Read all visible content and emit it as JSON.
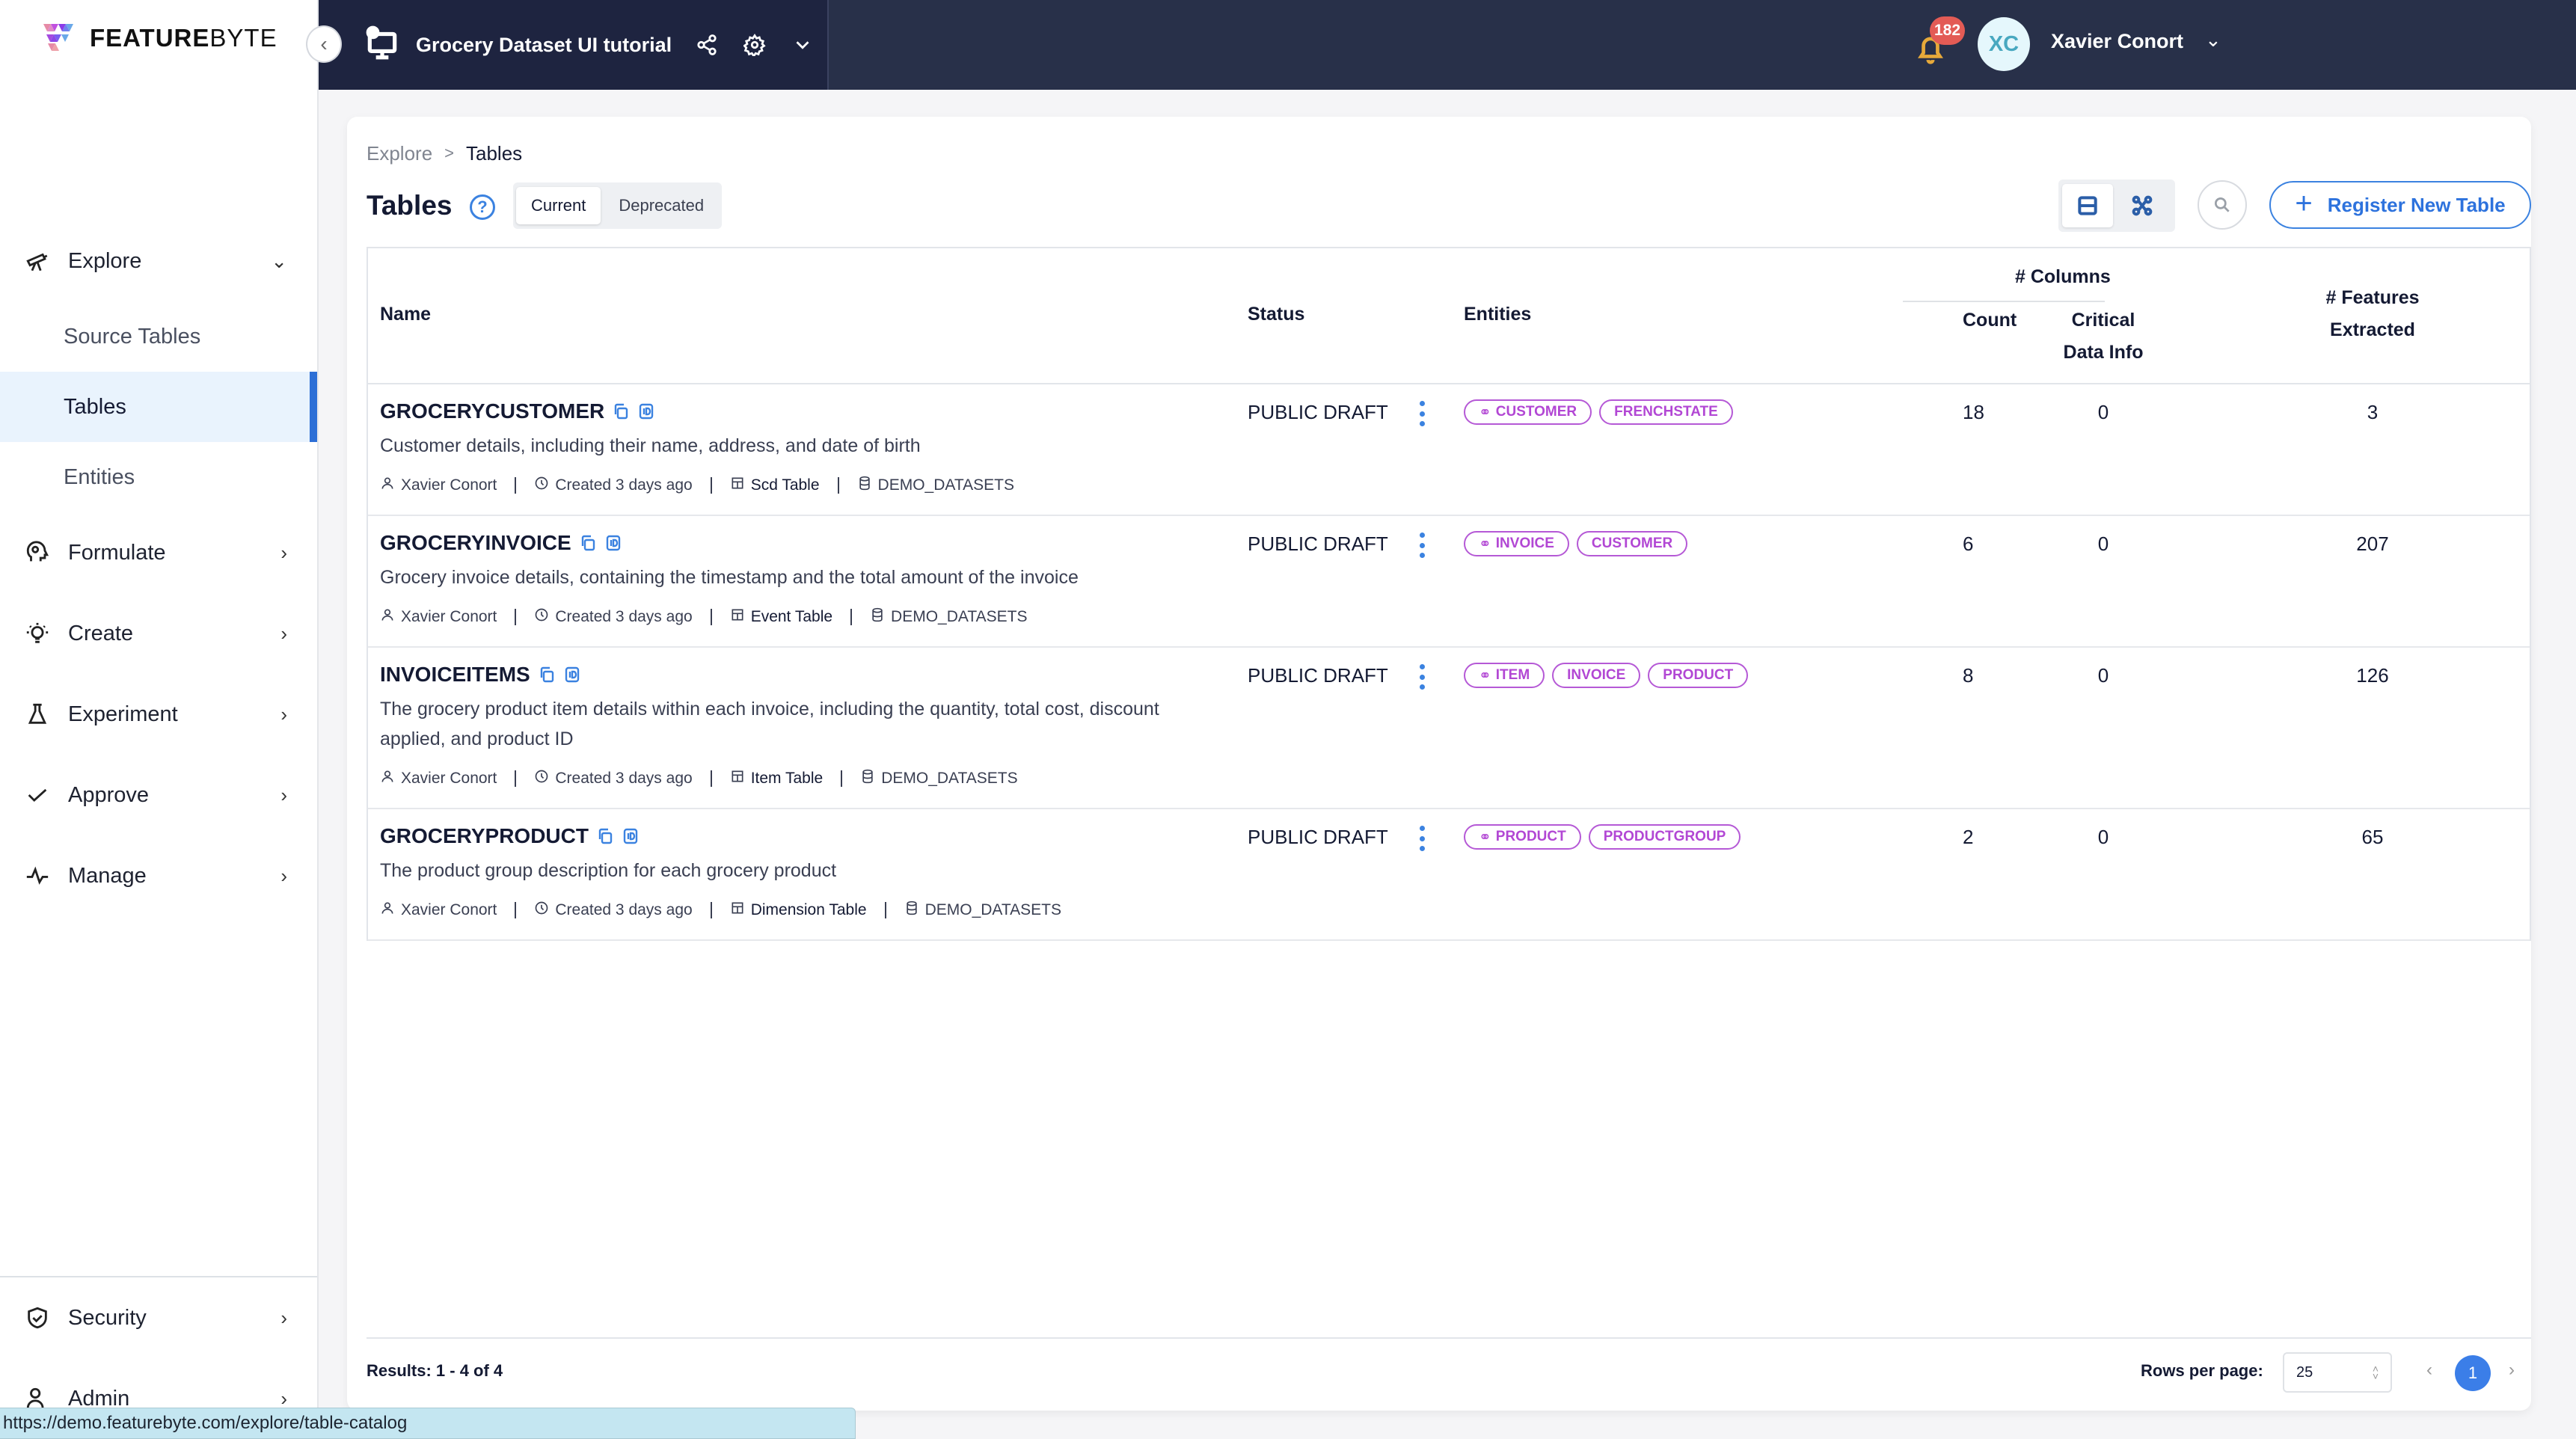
{
  "brand": {
    "name_bold": "FEATURE",
    "name_light": "BYTE"
  },
  "topbar": {
    "project_title": "Grocery Dataset UI tutorial",
    "notification_count": "182",
    "user_initials": "XC",
    "user_name": "Xavier Conort",
    "colors": {
      "bar": "#283049",
      "badge": "#e35b55",
      "bell": "#e7a93a"
    }
  },
  "sidebar": {
    "items": [
      {
        "label": "Explore",
        "icon": "telescope-icon",
        "expanded": true,
        "children": [
          {
            "label": "Source Tables",
            "active": false
          },
          {
            "label": "Tables",
            "active": true
          },
          {
            "label": "Entities",
            "active": false
          }
        ]
      },
      {
        "label": "Formulate",
        "icon": "brain-gear-icon"
      },
      {
        "label": "Create",
        "icon": "lightbulb-icon"
      },
      {
        "label": "Experiment",
        "icon": "flask-icon"
      },
      {
        "label": "Approve",
        "icon": "check-icon"
      },
      {
        "label": "Manage",
        "icon": "pulse-icon"
      }
    ],
    "bottom_items": [
      {
        "label": "Security",
        "icon": "shield-check-icon"
      },
      {
        "label": "Admin",
        "icon": "users-icon"
      }
    ]
  },
  "breadcrumb": {
    "parent": "Explore",
    "separator": ">",
    "current": "Tables"
  },
  "page": {
    "title": "Tables",
    "help": "?",
    "tabs": [
      {
        "label": "Current",
        "active": true
      },
      {
        "label": "Deprecated",
        "active": false
      }
    ],
    "register_label": "Register New Table",
    "accent_color": "#3b82e0"
  },
  "table": {
    "headers": {
      "name": "Name",
      "status": "Status",
      "entities": "Entities",
      "columns_group": "# Columns",
      "count": "Count",
      "critical_1": "Critical",
      "critical_2": "Data Info",
      "features_1": "# Features",
      "features_2": "Extracted"
    },
    "rows": [
      {
        "name": "GROCERYCUSTOMER",
        "description": "Customer details, including their name, address, and date of birth",
        "owner": "Xavier Conort",
        "created": "Created 3 days ago",
        "type": "Scd Table",
        "source": "DEMO_DATASETS",
        "status": "PUBLIC DRAFT",
        "entities": [
          {
            "label": "CUSTOMER",
            "primary": true
          },
          {
            "label": "FRENCHSTATE",
            "primary": false
          }
        ],
        "count": "18",
        "critical": "0",
        "features": "3"
      },
      {
        "name": "GROCERYINVOICE",
        "description": "Grocery invoice details, containing the timestamp and the total amount of the invoice",
        "owner": "Xavier Conort",
        "created": "Created 3 days ago",
        "type": "Event Table",
        "source": "DEMO_DATASETS",
        "status": "PUBLIC DRAFT",
        "entities": [
          {
            "label": "INVOICE",
            "primary": true
          },
          {
            "label": "CUSTOMER",
            "primary": false
          }
        ],
        "count": "6",
        "critical": "0",
        "features": "207"
      },
      {
        "name": "INVOICEITEMS",
        "description": "The grocery product item details within each invoice, including the quantity, total cost, discount applied, and product ID",
        "owner": "Xavier Conort",
        "created": "Created 3 days ago",
        "type": "Item Table",
        "source": "DEMO_DATASETS",
        "status": "PUBLIC DRAFT",
        "entities": [
          {
            "label": "ITEM",
            "primary": true
          },
          {
            "label": "INVOICE",
            "primary": false
          },
          {
            "label": "PRODUCT",
            "primary": false
          }
        ],
        "count": "8",
        "critical": "0",
        "features": "126"
      },
      {
        "name": "GROCERYPRODUCT",
        "description": "The product group description for each grocery product",
        "owner": "Xavier Conort",
        "created": "Created 3 days ago",
        "type": "Dimension Table",
        "source": "DEMO_DATASETS",
        "status": "PUBLIC DRAFT",
        "entities": [
          {
            "label": "PRODUCT",
            "primary": true
          },
          {
            "label": "PRODUCTGROUP",
            "primary": false
          }
        ],
        "count": "2",
        "critical": "0",
        "features": "65"
      }
    ],
    "entity_tag_color": "#b247d4"
  },
  "footer": {
    "results": "Results: 1 - 4 of 4",
    "rows_per_page_label": "Rows per page:",
    "rows_per_page_value": "25",
    "current_page": "1"
  },
  "status_url": "https://demo.featurebyte.com/explore/table-catalog"
}
